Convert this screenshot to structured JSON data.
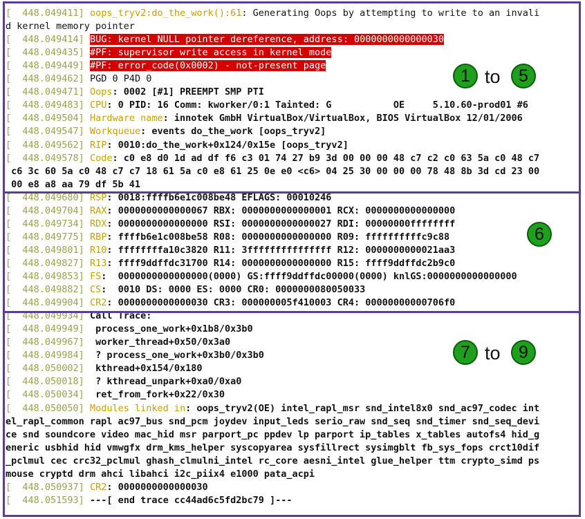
{
  "lines": [
    {
      "prefix": "[  ",
      "ts": "448.049411",
      "br": "] ",
      "hl": "oops_tryv2:do_the_work():61",
      "rest": ": Generating Oops by attempting to write to an invali",
      "bold": false
    },
    {
      "prefix": "",
      "ts": "",
      "br": "",
      "hl": "",
      "rest": "d kernel memory pointer",
      "bold": false
    },
    {
      "prefix": "[  ",
      "ts": "448.049414",
      "br": "] ",
      "hl": "BUG",
      "rest": ": kernel NULL pointer dereference, address: 0000000000000030",
      "red": true,
      "bold": false
    },
    {
      "prefix": "[  ",
      "ts": "448.049435",
      "br": "] ",
      "hl": "#PF",
      "rest": ": supervisor write access in kernel mode",
      "red": true,
      "bold": false
    },
    {
      "prefix": "[  ",
      "ts": "448.049449",
      "br": "] ",
      "hl": "#PF",
      "rest": ": error_code(0x0002) - not-present page",
      "red": true,
      "bold": false
    },
    {
      "prefix": "[  ",
      "ts": "448.049462",
      "br": "] ",
      "hl": "",
      "rest": "PGD 0 P4D 0",
      "bold": false
    },
    {
      "prefix": "[  ",
      "ts": "448.049471",
      "br": "] ",
      "hl": "Oops",
      "rest": ": 0002 [#1] PREEMPT SMP PTI",
      "bold": true
    },
    {
      "prefix": "[  ",
      "ts": "448.049483",
      "br": "] ",
      "hl": "CPU",
      "rest": ": 0 PID: 16 Comm: kworker/0:1 Tainted: G           OE     5.10.60-prod01 #6",
      "bold": true
    },
    {
      "prefix": "[  ",
      "ts": "448.049504",
      "br": "] ",
      "hl": "Hardware name",
      "rest": ": innotek GmbH VirtualBox/VirtualBox, BIOS VirtualBox 12/01/2006",
      "bold": true
    },
    {
      "prefix": "[  ",
      "ts": "448.049547",
      "br": "] ",
      "hl": "Workqueue",
      "rest": ": events do_the_work [oops_tryv2]",
      "bold": true
    },
    {
      "prefix": "[  ",
      "ts": "448.049562",
      "br": "] ",
      "hl": "RIP",
      "rest": ": 0010:do_the_work+0x124/0x15e [oops_tryv2]",
      "bold": true
    },
    {
      "prefix": "[  ",
      "ts": "448.049578",
      "br": "] ",
      "hl": "Code",
      "rest": ": c0 e8 d0 1d ad df f6 c3 01 74 27 b9 3d 00 00 00 48 c7 c2 c0 63 5a c0 48 c7",
      "bold": true
    },
    {
      "prefix": "",
      "ts": "",
      "br": "",
      "hl": "",
      "rest": " c6 3c 60 5a c0 48 c7 c7 18 61 5a c0 e8 61 25 0e e0 <c6> 04 25 30 00 00 00 78 48 8b 3d cd 23 00",
      "bold": true
    },
    {
      "prefix": "",
      "ts": "",
      "br": "",
      "hl": "",
      "rest": " 00 e8 a8 aa 79 df 5b 41",
      "bold": true
    },
    {
      "prefix": "[  ",
      "ts": "448.049680",
      "br": "] ",
      "hl": "RSP",
      "rest": ": 0018:ffffb6e1c008be48 EFLAGS: 00010246",
      "bold": true
    },
    {
      "prefix": "[  ",
      "ts": "448.049704",
      "br": "] ",
      "hl": "RAX",
      "rest": ": 0000000000000067 RBX: 0000000000000001 RCX: 0000000000000000",
      "bold": true
    },
    {
      "prefix": "[  ",
      "ts": "448.049734",
      "br": "] ",
      "hl": "RDX",
      "rest": ": 0000000000000000 RSI: 0000000000000027 RDI: 00000000ffffffff",
      "bold": true
    },
    {
      "prefix": "[  ",
      "ts": "448.049775",
      "br": "] ",
      "hl": "RBP",
      "rest": ": ffffb6e1c008be58 R08: 0000000000000000 R09: ffffffffffc9c88",
      "bold": true
    },
    {
      "prefix": "[  ",
      "ts": "448.049801",
      "br": "] ",
      "hl": "R10",
      "rest": ": ffffffffa10c3820 R11: 3fffffffffffffff R12: 0000000000021aa3",
      "bold": true
    },
    {
      "prefix": "[  ",
      "ts": "448.049827",
      "br": "] ",
      "hl": "R13",
      "rest": ": ffff9ddffdc31700 R14: 0000000000000000 R15: ffff9ddffdc2b9c0",
      "bold": true
    },
    {
      "prefix": "[  ",
      "ts": "448.049853",
      "br": "] ",
      "hl": "FS",
      "rest": ":  0000000000000000(0000) GS:ffff9ddffdc00000(0000) knlGS:0000000000000000",
      "bold": true
    },
    {
      "prefix": "[  ",
      "ts": "448.049882",
      "br": "] ",
      "hl": "CS",
      "rest": ":  0010 DS: 0000 ES: 0000 CR0: 0000000080050033",
      "bold": true
    },
    {
      "prefix": "[  ",
      "ts": "448.049904",
      "br": "] ",
      "hl": "CR2",
      "rest": ": 0000000000000030 CR3: 000000005f410003 CR4: 00000000000706f0",
      "bold": true
    },
    {
      "prefix": "[  ",
      "ts": "448.049934",
      "br": "] ",
      "hl": "",
      "rest": "Call Trace:",
      "bold": true
    },
    {
      "prefix": "[  ",
      "ts": "448.049949",
      "br": "] ",
      "hl": "",
      "rest": " process_one_work+0x1b8/0x3b0",
      "bold": true
    },
    {
      "prefix": "[  ",
      "ts": "448.049967",
      "br": "] ",
      "hl": "",
      "rest": " worker_thread+0x50/0x3a0",
      "bold": true
    },
    {
      "prefix": "[  ",
      "ts": "448.049984",
      "br": "] ",
      "hl": "",
      "rest": " ? process_one_work+0x3b0/0x3b0",
      "bold": true
    },
    {
      "prefix": "[  ",
      "ts": "448.050002",
      "br": "] ",
      "hl": "",
      "rest": " kthread+0x154/0x180",
      "bold": true
    },
    {
      "prefix": "[  ",
      "ts": "448.050018",
      "br": "] ",
      "hl": "",
      "rest": " ? kthread_unpark+0xa0/0xa0",
      "bold": true
    },
    {
      "prefix": "[  ",
      "ts": "448.050034",
      "br": "] ",
      "hl": "",
      "rest": " ret_from_fork+0x22/0x30",
      "bold": true
    },
    {
      "prefix": "[  ",
      "ts": "448.050050",
      "br": "] ",
      "hl": "Modules linked in",
      "rest": ": oops_tryv2(OE) intel_rapl_msr snd_intel8x0 snd_ac97_codec int",
      "bold": true
    },
    {
      "prefix": "",
      "ts": "",
      "br": "",
      "hl": "",
      "rest": "el_rapl_common rapl ac97_bus snd_pcm joydev input_leds serio_raw snd_seq snd_timer snd_seq_devi",
      "bold": true
    },
    {
      "prefix": "",
      "ts": "",
      "br": "",
      "hl": "",
      "rest": "ce snd soundcore video mac_hid msr parport_pc ppdev lp parport ip_tables x_tables autofs4 hid_g",
      "bold": true
    },
    {
      "prefix": "",
      "ts": "",
      "br": "",
      "hl": "",
      "rest": "eneric usbhid hid vmwgfx drm_kms_helper syscopyarea sysfillrect sysimgblt fb_sys_fops crct10dif",
      "bold": true
    },
    {
      "prefix": "",
      "ts": "",
      "br": "",
      "hl": "",
      "rest": "_pclmul cec crc32_pclmul ghash_clmulni_intel rc_core aesni_intel glue_helper ttm crypto_simd ps",
      "bold": true
    },
    {
      "prefix": "",
      "ts": "",
      "br": "",
      "hl": "",
      "rest": "mouse cryptd drm ahci libahci i2c_piix4 e1000 pata_acpi",
      "bold": true
    },
    {
      "prefix": "[  ",
      "ts": "448.050937",
      "br": "] ",
      "hl": "CR2",
      "rest": ": 0000000000000030",
      "bold": true
    },
    {
      "prefix": "[  ",
      "ts": "448.051593",
      "br": "] ",
      "hl": "",
      "rest": "---[ end trace cc44ad6c5fd2bc79 ]---",
      "bold": true
    }
  ],
  "annotations": {
    "group1": {
      "from": "1",
      "to_word": "to",
      "to": "5"
    },
    "group2": {
      "label": "6"
    },
    "group3": {
      "from": "7",
      "to_word": "to",
      "to": "9"
    }
  },
  "colors": {
    "timestamp": "#9aa34a",
    "highlight": "#c7a100",
    "bug_background": "#d40000",
    "box_border": "#5b3c9a",
    "badge": "#1ea01e"
  }
}
